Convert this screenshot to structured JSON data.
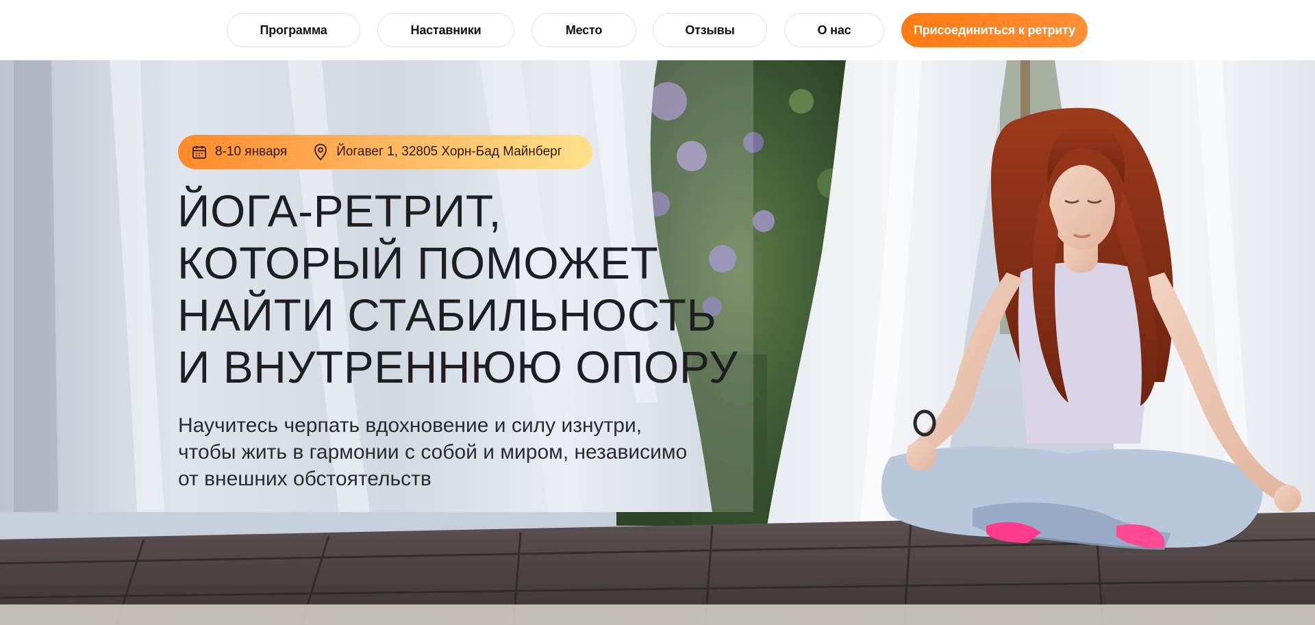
{
  "nav": {
    "items": [
      {
        "label": "Программа"
      },
      {
        "label": "Наставники"
      },
      {
        "label": "Место"
      },
      {
        "label": "Отзывы"
      },
      {
        "label": "О нас"
      }
    ],
    "cta_label": "Присоединиться к ретриту"
  },
  "hero": {
    "date": "8-10 января",
    "address": "Йогавег 1, 32805 Хорн-Бад Майнберг",
    "headline_lines": [
      "Йога-ретрит,",
      "который поможет",
      "найти стабильность",
      "и внутреннюю опору"
    ],
    "subtitle_lines": [
      "Научитесь черпать вдохновение и силу изнутри,",
      "чтобы жить в гармонии с собой и миром, независимо",
      "от внешних обстоятельств"
    ],
    "icons": {
      "date": "calendar-icon",
      "address": "map-pin-icon"
    }
  },
  "colors": {
    "accent": "#ff7a12",
    "pill_gradient_end": "#ffe08a",
    "text_dark": "#1f1f22"
  }
}
